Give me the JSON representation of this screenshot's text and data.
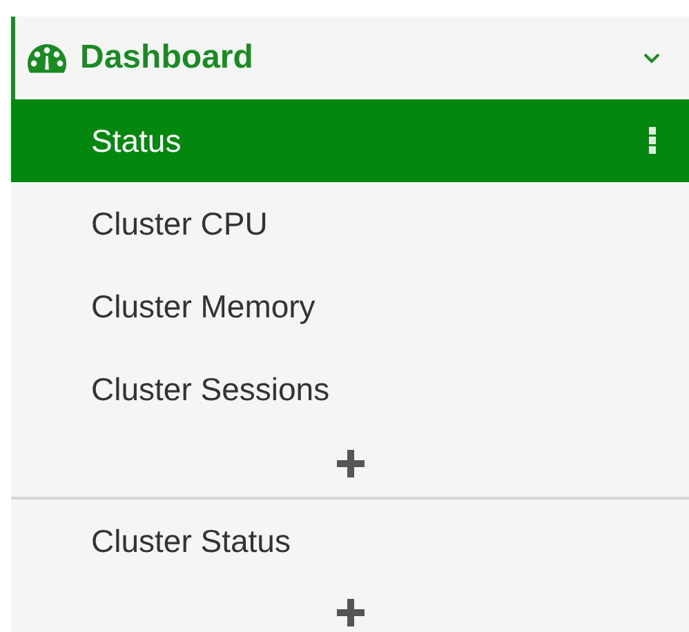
{
  "menu": {
    "title": "Dashboard",
    "expanded": true,
    "groups": [
      {
        "items": [
          {
            "label": "Status",
            "selected": true
          },
          {
            "label": "Cluster CPU",
            "selected": false
          },
          {
            "label": "Cluster Memory",
            "selected": false
          },
          {
            "label": "Cluster Sessions",
            "selected": false
          }
        ]
      },
      {
        "items": [
          {
            "label": "Cluster Status",
            "selected": false
          }
        ]
      }
    ]
  }
}
